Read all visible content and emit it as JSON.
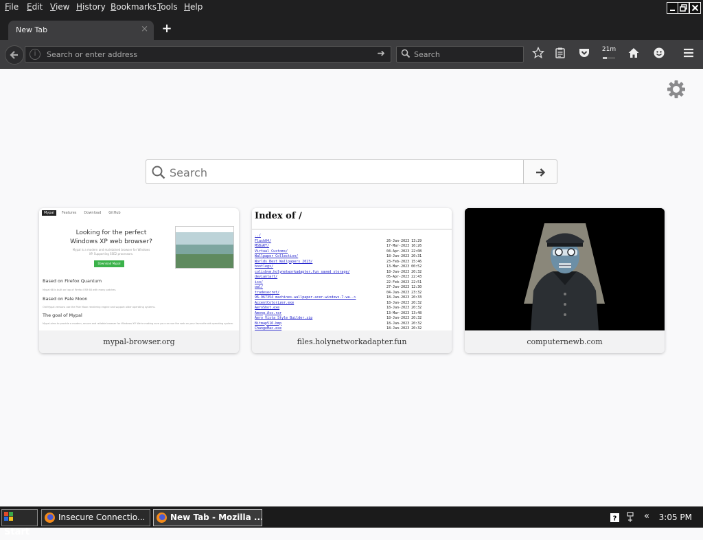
{
  "menubar": {
    "items": [
      {
        "key": "F",
        "rest": "ile"
      },
      {
        "key": "E",
        "rest": "dit"
      },
      {
        "key": "V",
        "rest": "iew"
      },
      {
        "key": "H",
        "rest": "istory"
      },
      {
        "key": "B",
        "rest": "ookmarks"
      },
      {
        "key": "T",
        "rest": "ools"
      },
      {
        "key": "H",
        "rest": "elp"
      }
    ],
    "window_buttons": [
      "minimize-icon",
      "restore-icon",
      "close-icon"
    ]
  },
  "tabs": {
    "active_title": "New Tab",
    "close_glyph": "×",
    "new_tab_glyph": "+"
  },
  "navbar": {
    "url_placeholder": "Search or enter address",
    "search_placeholder": "Search",
    "download_time": "21m",
    "download_progress": 0.35
  },
  "newtab": {
    "search_placeholder": "Search",
    "tiles": [
      {
        "label": "mypal-browser.org"
      },
      {
        "label": "files.holynetworkadapter.fun"
      },
      {
        "label": "computernewb.com"
      }
    ]
  },
  "mypal_thumb": {
    "nav": [
      "Mypal",
      "Features",
      "Download",
      "GitHub"
    ],
    "headline_1": "Looking for the perfect",
    "headline_2": "Windows XP web browser?",
    "sub": "Mypal is a modern and maintained browser for Windows XP. Supporting SSE2 processors.",
    "download": "Download Mypal",
    "h1": "Based on Firefox Quantum",
    "p1": "Mypal 68 is built on top of Firefox ESR 68 with many patches.",
    "h2": "Based on Pale Moon",
    "p2": "Old Mypal versions use the Pale Moon rendering engine and support older operating systems.",
    "h3": "The goal of Mypal",
    "p3": "Mypal aims to provide a modern, secure and reliable browser for Windows XP. We're making sure you can use the web on your favourite old operating system."
  },
  "index_thumb": {
    "title": "Index of /",
    "rows": [
      {
        "name": "../",
        "date": ""
      },
      {
        "name": "Flash04/",
        "date": "26-Jan-2023 13:29"
      },
      {
        "name": "MSBuRT/",
        "date": "17-Mar-2023 16:26"
      },
      {
        "name": "Virtual Customs/",
        "date": "04-Apr-2023 22:08"
      },
      {
        "name": "Wallpaper Collection/",
        "date": "18-Jan-2023 20:31"
      },
      {
        "name": "Worlds Best Wallpapers 2023/",
        "date": "23-Feb-2023 15:46"
      },
      {
        "name": "bootlegs/",
        "date": "13-Mar-2023 00:52"
      },
      {
        "name": "colisbvm.holynetworkadapter.fun saved storage/",
        "date": "18-Jan-2023 20:32"
      },
      {
        "name": "deviantart/",
        "date": "05-Apr-2023 22:43"
      },
      {
        "name": "iso/",
        "date": "22-Feb-2023 22:51"
      },
      {
        "name": "owl/",
        "date": "27-Jan-2023 12:30"
      },
      {
        "name": "tradesecret/",
        "date": "04-Jan-2023 23:32"
      },
      {
        "name": "96-967354_machines-wallpaper-acer-windows-7-wa..>",
        "date": "18-Jan-2023 20:33"
      },
      {
        "name": "AccentColorizer.exe",
        "date": "18-Jan-2023 20:32"
      },
      {
        "name": "AeroShot.exe",
        "date": "18-Jan-2023 20:32"
      },
      {
        "name": "Among.Ass.rar",
        "date": "13-Mar-2023 13:48"
      },
      {
        "name": "Aero Vista Style Builder.zip",
        "date": "18-Jan-2023 20:32"
      },
      {
        "name": "Bitmap516.bmp",
        "date": "18-Jan-2023 20:32"
      },
      {
        "name": "ChangeMac.exe",
        "date": "18-Jan-2023 20:32"
      }
    ]
  },
  "taskbar": {
    "start_label": "Start",
    "tasks": [
      {
        "label": "Insecure Connectio..."
      },
      {
        "label": "New Tab - Mozilla ..."
      }
    ],
    "tray_chevron": "«",
    "clock": "3:05 PM"
  },
  "colors": {
    "chrome_dark": "#1f1f20",
    "toolbar": "#3d3d3f",
    "page_bg": "#f9f9fa",
    "link_blue": "#2222cc",
    "download_green": "#3bb24a"
  }
}
